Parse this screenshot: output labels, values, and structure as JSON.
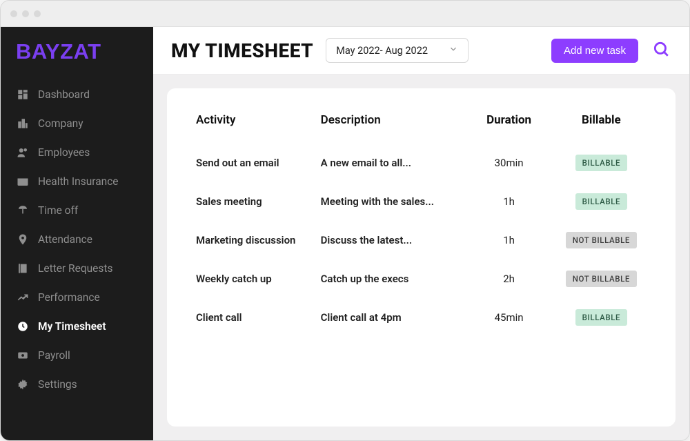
{
  "brand": "BAYZAT",
  "sidebar": {
    "items": [
      {
        "label": "Dashboard",
        "icon": "dashboard-icon",
        "active": false
      },
      {
        "label": "Company",
        "icon": "company-icon",
        "active": false
      },
      {
        "label": "Employees",
        "icon": "employees-icon",
        "active": false
      },
      {
        "label": "Health Insurance",
        "icon": "health-icon",
        "active": false
      },
      {
        "label": "Time off",
        "icon": "timeoff-icon",
        "active": false
      },
      {
        "label": "Attendance",
        "icon": "attendance-icon",
        "active": false
      },
      {
        "label": "Letter Requests",
        "icon": "letter-icon",
        "active": false
      },
      {
        "label": "Performance",
        "icon": "performance-icon",
        "active": false
      },
      {
        "label": "My Timesheet",
        "icon": "timesheet-icon",
        "active": true
      },
      {
        "label": "Payroll",
        "icon": "payroll-icon",
        "active": false
      },
      {
        "label": "Settings",
        "icon": "settings-icon",
        "active": false
      }
    ]
  },
  "header": {
    "title": "MY TIMESHEET",
    "date_range": "May 2022- Aug 2022",
    "add_button": "Add new task"
  },
  "table": {
    "headers": {
      "activity": "Activity",
      "description": "Description",
      "duration": "Duration",
      "billable": "Billable"
    },
    "rows": [
      {
        "activity": "Send out an email",
        "description": "A new email to all...",
        "duration": "30min",
        "billable": true,
        "badge": "BILLABLE"
      },
      {
        "activity": "Sales meeting",
        "description": "Meeting with the sales...",
        "duration": "1h",
        "billable": true,
        "badge": "BILLABLE"
      },
      {
        "activity": "Marketing discussion",
        "description": "Discuss the latest...",
        "duration": "1h",
        "billable": false,
        "badge": "NOT BILLABLE"
      },
      {
        "activity": "Weekly catch up",
        "description": "Catch up the execs",
        "duration": "2h",
        "billable": false,
        "badge": "NOT BILLABLE"
      },
      {
        "activity": "Client call",
        "description": "Client call at 4pm",
        "duration": "45min",
        "billable": true,
        "badge": "BILLABLE"
      }
    ]
  },
  "colors": {
    "accent": "#8d3dff",
    "sidebar_bg": "#1c1c1c"
  }
}
